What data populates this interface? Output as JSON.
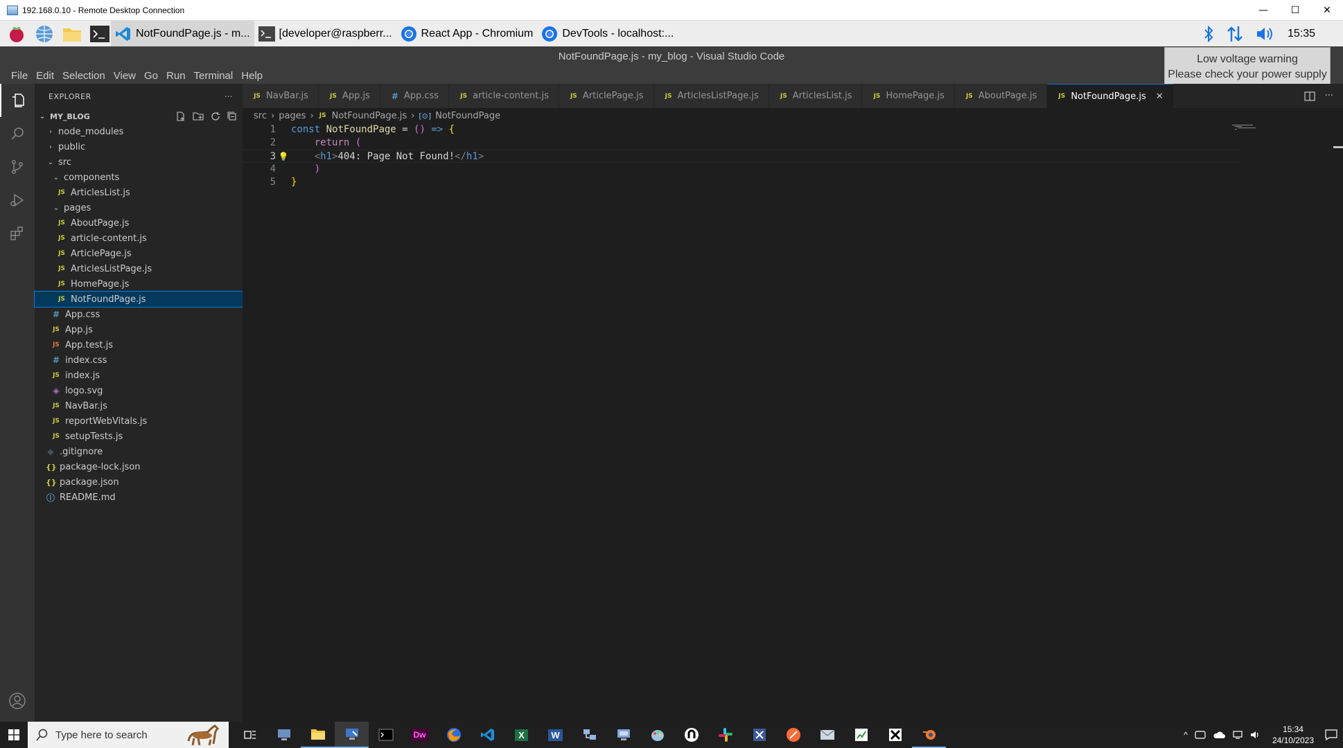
{
  "rdp": {
    "title": "192.168.0.10 - Remote Desktop Connection",
    "minimize": "—",
    "maximize": "☐",
    "close": "✕"
  },
  "pi_panel": {
    "tasks": [
      {
        "label": "NotFoundPage.js - m...",
        "icon": "vscode-icon"
      },
      {
        "label": "[developer@raspberr...",
        "icon": "terminal-icon"
      },
      {
        "label": "React App - Chromium",
        "icon": "chromium-icon"
      },
      {
        "label": "DevTools - localhost:...",
        "icon": "chromium-icon"
      }
    ],
    "clock": "15:35"
  },
  "voltage_warning": {
    "line1": "Low voltage warning",
    "line2": "Please check your power supply"
  },
  "vscode": {
    "title": "NotFoundPage.js - my_blog - Visual Studio Code",
    "menu": [
      "File",
      "Edit",
      "Selection",
      "View",
      "Go",
      "Run",
      "Terminal",
      "Help"
    ],
    "explorer": {
      "header": "EXPLORER",
      "more": "···",
      "folder": "MY_BLOG",
      "tree": {
        "node_modules": "node_modules",
        "public": "public",
        "src": "src",
        "components": "components",
        "articles_list": "ArticlesList.js",
        "pages": "pages",
        "about_page": "AboutPage.js",
        "article_content": "article-content.js",
        "article_page": "ArticlePage.js",
        "articles_list_page": "ArticlesListPage.js",
        "home_page": "HomePage.js",
        "not_found_page": "NotFoundPage.js",
        "app_css": "App.css",
        "app_js": "App.js",
        "app_test": "App.test.js",
        "index_css": "index.css",
        "index_js": "index.js",
        "logo_svg": "logo.svg",
        "navbar": "NavBar.js",
        "report_web_vitals": "reportWebVitals.js",
        "setup_tests": "setupTests.js",
        "gitignore": ".gitignore",
        "package_lock": "package-lock.json",
        "package_json": "package.json",
        "readme": "README.md"
      }
    },
    "tabs": [
      {
        "label": "NavBar.js",
        "type": "JS"
      },
      {
        "label": "App.js",
        "type": "JS"
      },
      {
        "label": "App.css",
        "type": "#"
      },
      {
        "label": "article-content.js",
        "type": "JS"
      },
      {
        "label": "ArticlePage.js",
        "type": "JS"
      },
      {
        "label": "ArticlesListPage.js",
        "type": "JS"
      },
      {
        "label": "ArticlesList.js",
        "type": "JS"
      },
      {
        "label": "HomePage.js",
        "type": "JS"
      },
      {
        "label": "AboutPage.js",
        "type": "JS"
      },
      {
        "label": "NotFoundPage.js",
        "type": "JS",
        "active": true
      }
    ],
    "breadcrumb": [
      "src",
      "pages",
      "NotFoundPage.js",
      "NotFoundPage"
    ],
    "code": {
      "line_numbers": [
        "1",
        "2",
        "3",
        "4",
        "5"
      ],
      "l1_kw": "const",
      "l1_name": "NotFoundPage",
      "l1_op": " = ",
      "l1_parens": "()",
      "l1_arrow": " => ",
      "l1_brace": "{",
      "l2_ret": "return",
      "l2_paren": "(",
      "l3_open_lt": "<",
      "l3_open_tag": "h1",
      "l3_open_gt": ">",
      "l3_text": "404: Page Not Found!",
      "l3_close_lt": "</",
      "l3_close_tag": "h1",
      "l3_close_gt": ">",
      "l4_paren": ")",
      "l5_brace": "}"
    }
  },
  "win_taskbar": {
    "search_placeholder": "Type here to search",
    "apps": [
      "Dw",
      "X",
      "W"
    ],
    "time": "15:34",
    "date": "24/10/2023"
  }
}
